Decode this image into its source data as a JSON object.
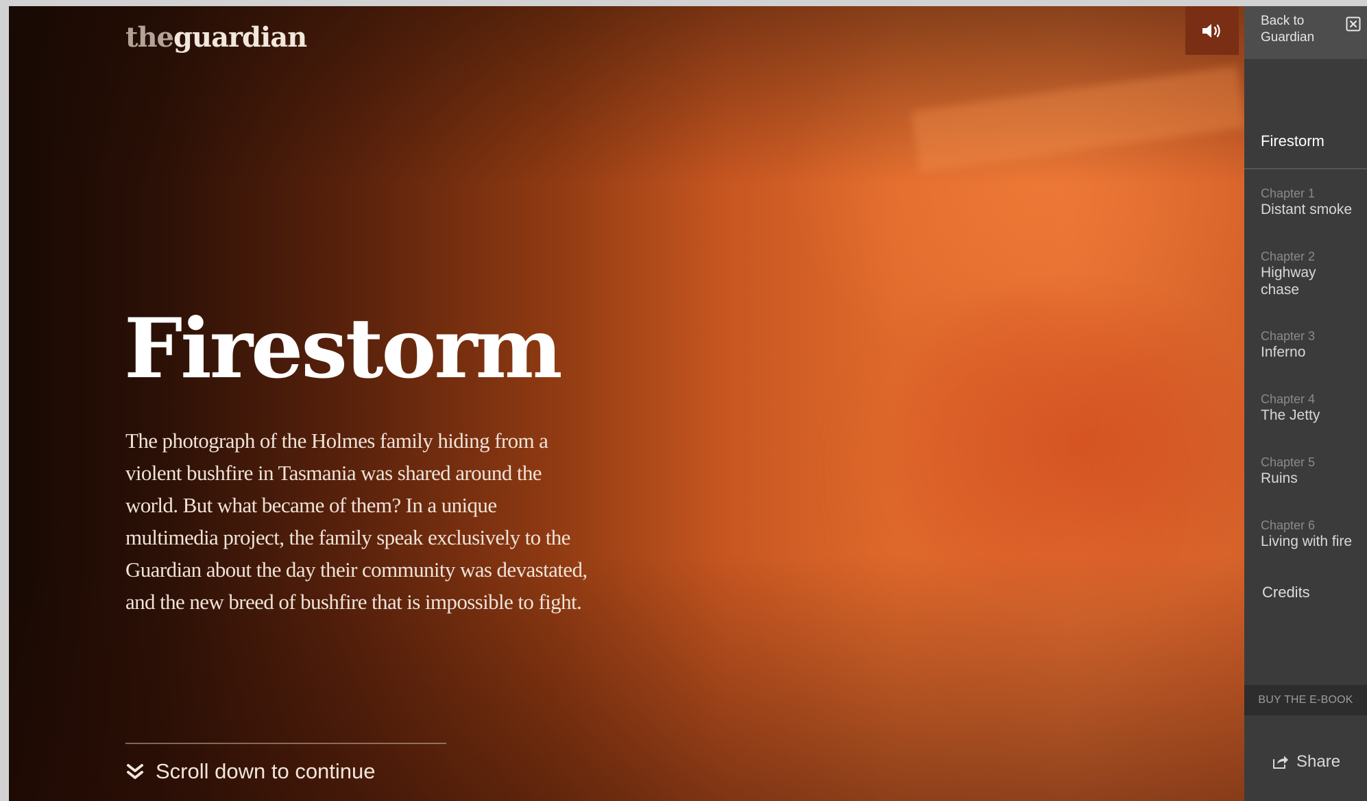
{
  "header": {
    "logo_prefix": "the",
    "logo_name": "guardian"
  },
  "hero": {
    "title": "Firestorm",
    "standfirst": "The photograph of the Holmes family hiding from a violent bushfire in Tasmania was shared around the world. But what became of them? In a unique multimedia project, the family speak exclusively to the Guardian about the day their community was devastated, and the new breed of bushfire that is impossible to fight.",
    "scroll_label": "Scroll down to continue"
  },
  "sidebar": {
    "back_label": "Back to Guardian",
    "title": "Firestorm",
    "chapters": [
      {
        "num": "Chapter 1",
        "name": "Distant smoke"
      },
      {
        "num": "Chapter 2",
        "name": "Highway chase"
      },
      {
        "num": "Chapter 3",
        "name": "Inferno"
      },
      {
        "num": "Chapter 4",
        "name": "The Jetty"
      },
      {
        "num": "Chapter 5",
        "name": "Ruins"
      },
      {
        "num": "Chapter 6",
        "name": "Living with fire"
      }
    ],
    "credits": "Credits",
    "ebook": "BUY THE E-BOOK",
    "share": "Share"
  },
  "icons": {
    "sound": "speaker-icon",
    "close": "close-icon",
    "scroll": "chevron-double-down-icon",
    "share": "share-icon"
  },
  "colors": {
    "sidebar_bg": "#3b3b3b",
    "sound_button_bg": "#7a2f14",
    "hero_orange": "#e06a2c"
  }
}
